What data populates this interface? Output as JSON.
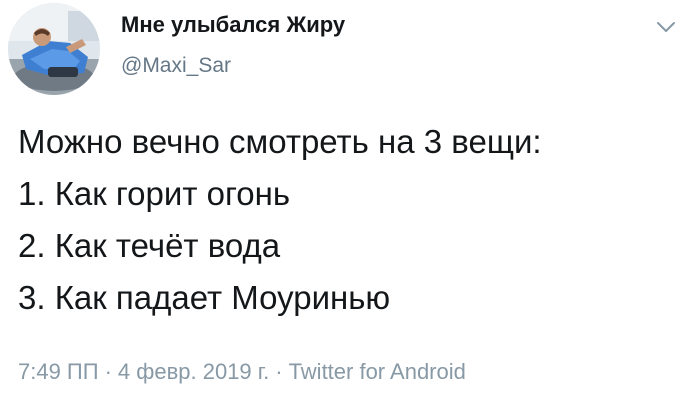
{
  "author": {
    "display_name": "Мне улыбался Жиру",
    "handle": "@Maxi_Sar",
    "avatar_icon": "user-avatar"
  },
  "menu": {
    "icon": "chevron-down-icon"
  },
  "tweet": {
    "lines": [
      "Можно вечно смотреть на 3 вещи:",
      "1. Как горит огонь",
      "2. Как течёт вода",
      "3. Как падает Моуринью"
    ]
  },
  "meta": {
    "time": "7:49 ПП",
    "separator": "·",
    "date": "4 февр. 2019 г.",
    "source": "Twitter for Android"
  },
  "colors": {
    "text": "#14171a",
    "secondary": "#657786",
    "meta": "#8899a6"
  }
}
